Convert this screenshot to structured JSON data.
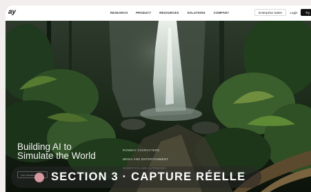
{
  "header": {
    "logo": "ay",
    "nav": [
      "RESEARCH",
      "PRODUCT",
      "RESOURCES",
      "SOLUTIONS",
      "COMPANY"
    ],
    "enterprise_sales": "Enterprise Sales",
    "login": "Login",
    "try": "Try"
  },
  "hero": {
    "headline_line1": "Building AI to",
    "headline_line2": "Simulate the World",
    "cta_label": "Get Started",
    "links": [
      "RUNWAY CHARACTERS",
      "MEDIA AND ENTERTAINMENT",
      "ROBOTICS AND AUTONOMY"
    ]
  },
  "overlay": {
    "label": "SECTION 3 · CAPTURE RÉELLE"
  },
  "colors": {
    "page_bg": "#f3eeee",
    "overlay_dot": "#e9a5ad",
    "try_button": "#111111"
  }
}
